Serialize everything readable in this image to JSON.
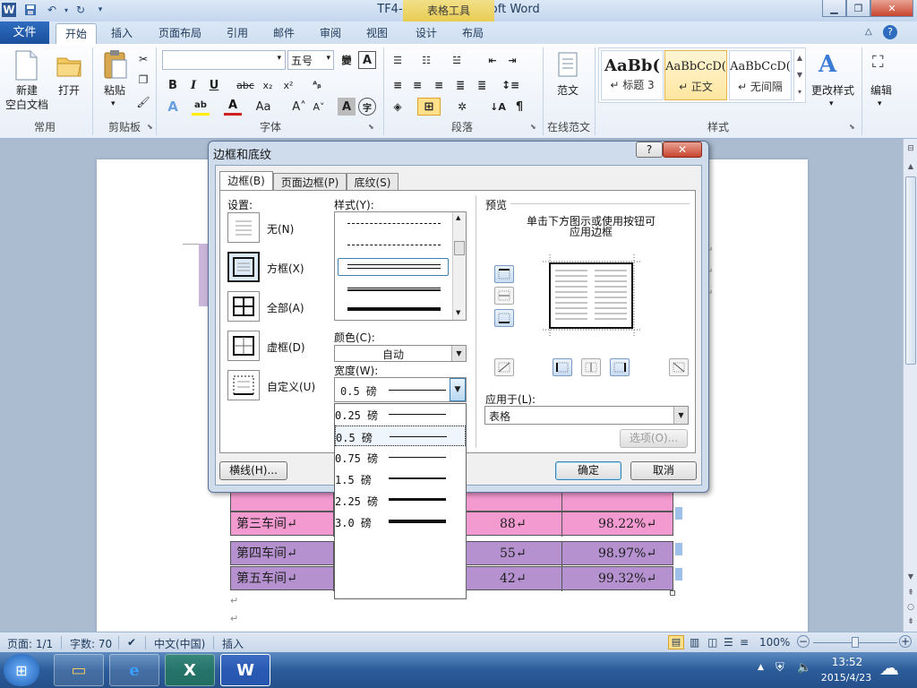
{
  "window": {
    "title": "TF4-1.docx - Microsoft Word",
    "context_tab": "表格工具"
  },
  "tabs": {
    "file": "文件",
    "items": [
      "开始",
      "插入",
      "页面布局",
      "引用",
      "邮件",
      "审阅",
      "视图",
      "设计",
      "布局"
    ]
  },
  "ribbon": {
    "groups": [
      "常用",
      "剪贴板",
      "字体",
      "段落",
      "在线范文",
      "样式"
    ],
    "new_doc": "新建\n空白文档",
    "open": "打开",
    "paste": "粘贴",
    "font_size": "五号",
    "fanwen": "范文",
    "styles": [
      {
        "sample": "AaBb(",
        "name": "↵ 标题 3"
      },
      {
        "sample": "AaBbCcD(",
        "name": "↵ 正文"
      },
      {
        "sample": "AaBbCcD(",
        "name": "↵ 无间隔"
      }
    ],
    "change_styles": "更改样式",
    "edit": "编辑"
  },
  "table": {
    "rows": [
      {
        "name": "第三车间↵",
        "count": "88↵",
        "rate": "98.22%↵",
        "color": "pink"
      },
      {
        "name": "第四车间↵",
        "count": "55↵",
        "rate": "98.97%↵",
        "color": "purple"
      },
      {
        "name": "第五车间↵",
        "count": "42↵",
        "rate": "99.32%↵",
        "color": "purple"
      }
    ]
  },
  "dialog": {
    "title": "边框和底纹",
    "tabs": [
      "边框(B)",
      "页面边框(P)",
      "底纹(S)"
    ],
    "settings_label": "设置:",
    "settings": [
      "无(N)",
      "方框(X)",
      "全部(A)",
      "虚框(D)",
      "自定义(U)"
    ],
    "style_label": "样式(Y):",
    "color_label": "颜色(C):",
    "color_value": "自动",
    "width_label": "宽度(W):",
    "width_value": "0.5 磅",
    "width_options": [
      "0.25 磅",
      "0.5 磅",
      "0.75 磅",
      "1.5 磅",
      "2.25 磅",
      "3.0 磅"
    ],
    "preview_label": "预览",
    "preview_hint_1": "单击下方图示或使用按钮可",
    "preview_hint_2": "应用边框",
    "apply_label": "应用于(L):",
    "apply_value": "表格",
    "options_button": "选项(O)...",
    "hline_button": "横线(H)...",
    "ok_button": "确定",
    "cancel_button": "取消"
  },
  "status": {
    "page": "页面: 1/1",
    "words": "字数: 70",
    "language": "中文(中国)",
    "insert": "插入",
    "zoom": "100%"
  },
  "taskbar": {
    "time": "13:52",
    "date": "2015/4/23"
  }
}
